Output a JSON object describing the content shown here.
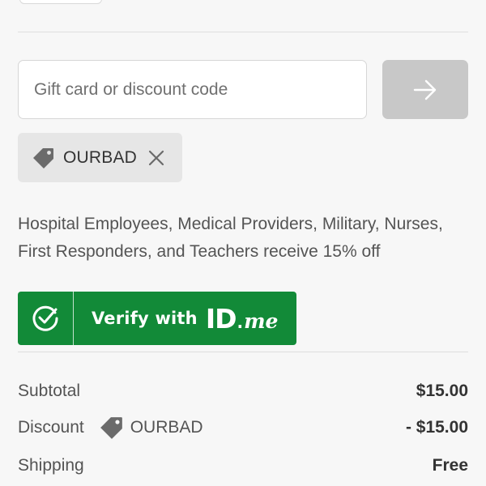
{
  "discount_form": {
    "input_value": "",
    "input_placeholder": "Gift card or discount code",
    "apply_button_icon": "arrow-right-icon"
  },
  "applied_code": {
    "icon": "tag-icon",
    "code": "OURBAD",
    "remove_icon": "close-icon"
  },
  "promo": {
    "text": "Hospital Employees, Medical Providers, Military, Nurses, First Responders, and Teachers receive 15% off"
  },
  "idme_button": {
    "icon": "check-circle-icon",
    "label": "Verify with",
    "logo_id": "ID",
    "logo_dot": ".",
    "logo_me": "me",
    "color": "#128a38"
  },
  "summary": {
    "subtotal": {
      "label": "Subtotal",
      "value": "$15.00"
    },
    "discount": {
      "label": "Discount",
      "code": "OURBAD",
      "icon": "tag-icon",
      "value": "- $15.00"
    },
    "shipping": {
      "label": "Shipping",
      "value": "Free"
    }
  }
}
